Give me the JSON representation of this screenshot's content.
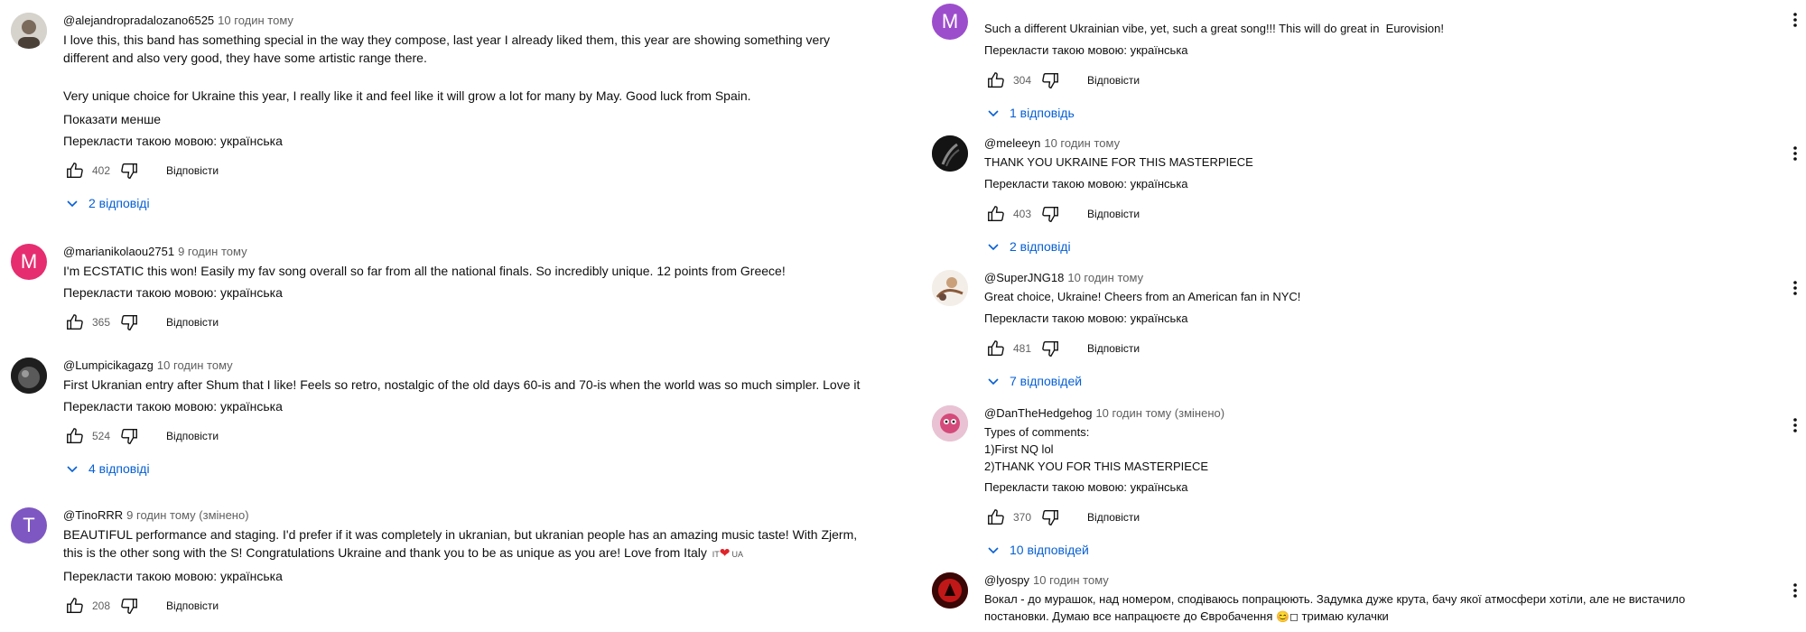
{
  "common": {
    "translate_label": "Перекласти такою мовою: українська",
    "reply_label": "Відповісти",
    "show_less_label": "Показати менше"
  },
  "left": [
    {
      "author": "@alejandropradalozano6525",
      "time": "10 годин тому",
      "avatar_color": "#c8c8c8",
      "avatar_letter": "",
      "text1": "I love this, this band has something special in the way they compose, last year I already liked them, this year are showing something very\ndifferent and also very good, they have some artistic range there.",
      "text2": "Very unique choice for Ukraine this year, I really like it and feel like it will grow a lot for many by May. Good luck from Spain.",
      "likes": "402",
      "replies": "2 відповіді"
    },
    {
      "author": "@marianikolaou2751",
      "time": "9 годин тому",
      "avatar_color": "#e52d6f",
      "avatar_letter": "M",
      "text1": "I'm ECSTATIC this won! Easily my fav song overall so far from all the national finals. So incredibly unique. 12 points from Greece!",
      "likes": "365"
    },
    {
      "author": "@Lumpicikagazg",
      "time": "10 годин тому",
      "avatar_color": "#2a2a2a",
      "avatar_letter": "",
      "text1": "First Ukranian entry after Shum that I like! Feels so retro, nostalgic of the old days 60-is and 70-is when the world was so much simpler. Love it",
      "likes": "524",
      "replies": "4 відповіді"
    },
    {
      "author": "@TinoRRR",
      "time": "9 годин тому (змінено)",
      "avatar_color": "#7e57c2",
      "avatar_letter": "T",
      "text1": "BEAUTIFUL performance and staging. I'd prefer if it was completely in ukranian, but ukranian people has an amazing music taste! With Zjerm,\nthis is the other song with the S! Congratulations Ukraine and thank you to be as unique as you are! Love from Italy",
      "flag1": "IT",
      "flag2": "UA",
      "likes": "208"
    }
  ],
  "right": [
    {
      "author": "",
      "avatar_color": "#9c4dcc",
      "avatar_letter": "M",
      "text1": "Such a different Ukrainian vibe, yet, such a great song!!! This will do great in  Eurovision!",
      "likes": "304",
      "replies": "1 відповідь"
    },
    {
      "author": "@meleeyn",
      "time": "10 годин тому",
      "avatar_color": "#1a1a1a",
      "avatar_letter": "",
      "text1": "THANK YOU UKRAINE FOR THIS MASTERPIECE",
      "likes": "403",
      "replies": "2 відповіді"
    },
    {
      "author": "@SuperJNG18",
      "time": "10 годин тому",
      "avatar_color": "#e8e0d8",
      "avatar_letter": "",
      "text1": "Great choice, Ukraine! Cheers from an American fan in NYC!",
      "likes": "481",
      "replies": "7 відповідей"
    },
    {
      "author": "@DanTheHedgehog",
      "time": "10 годин тому (змінено)",
      "avatar_color": "#d4a0b8",
      "avatar_letter": "",
      "text1": "Types of comments:\n1)First NQ lol\n2)THANK YOU FOR THIS MASTERPIECE",
      "likes": "370",
      "replies": "10 відповідей"
    },
    {
      "author": "@lyospy",
      "time": "10 годин тому",
      "avatar_color": "#b01010",
      "avatar_letter": "",
      "text1": "Вокал - до мурашок, над номером, сподіваюсь попрацюють. Задумка дуже крута, бачу якої атмосфери хотіли, але не вистачило\nпостановки. Думаю все напрацюєте до Євробачення",
      "text_tail": "тримаю кулачки"
    }
  ]
}
